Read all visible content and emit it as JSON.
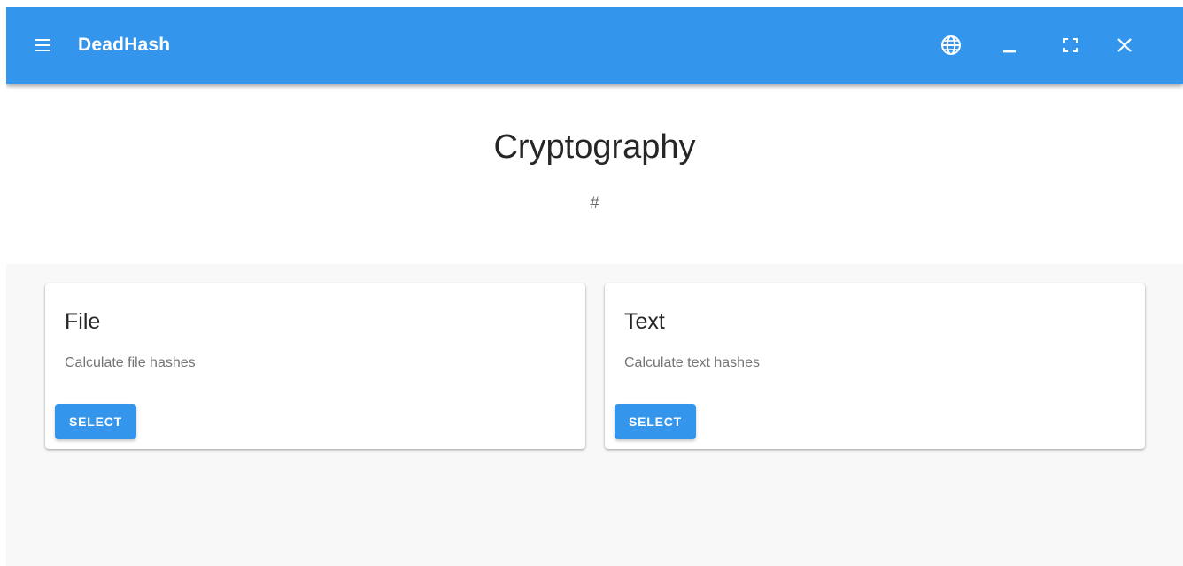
{
  "app": {
    "title": "DeadHash",
    "accent_color": "#3395ec"
  },
  "toolbar": {
    "menu_icon": "hamburger-menu-icon",
    "controls": [
      {
        "name": "language",
        "icon": "globe-icon"
      },
      {
        "name": "minimize",
        "icon": "minimize-icon"
      },
      {
        "name": "fullscreen",
        "icon": "fullscreen-icon"
      },
      {
        "name": "close",
        "icon": "close-icon"
      }
    ]
  },
  "page": {
    "title": "Cryptography",
    "subtitle": "#"
  },
  "cards": [
    {
      "title": "File",
      "description": "Calculate file hashes",
      "button_label": "SELECT"
    },
    {
      "title": "Text",
      "description": "Calculate text hashes",
      "button_label": "SELECT"
    }
  ]
}
